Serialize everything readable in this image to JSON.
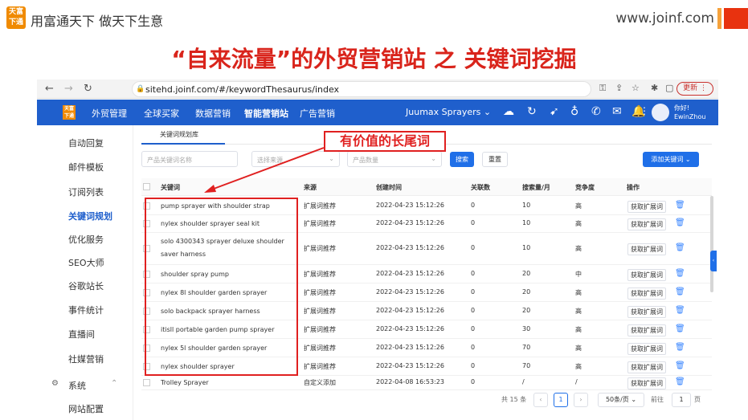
{
  "slide": {
    "logo_line1": "天富",
    "logo_line2": "下通",
    "company": "用富通天下  做天下生意",
    "site_url": "www.joinf.com",
    "title": "“自来流量”的外贸营销站 之 关键词挖掘"
  },
  "browser": {
    "url": "sitehd.joinf.com/#/keywordThesaurus/index",
    "update_label": "更新"
  },
  "topnav": {
    "logo_text": "天富下通",
    "items": [
      "外贸管理",
      "全球买家",
      "数据营销",
      "智能营销站",
      "广告营销"
    ],
    "active_index": 3,
    "product": "Juumax Sprayers",
    "user_greeting": "你好!",
    "user_name": "EwinZhou"
  },
  "sidebar": {
    "items": [
      "自动回复",
      "邮件模板",
      "订阅列表",
      "关键词规划",
      "优化服务",
      "SEO大师",
      "谷歌站长",
      "事件统计",
      "直播间",
      "社媒营销",
      "系统",
      "网站配置"
    ],
    "active_index": 3
  },
  "tab_label": "关键词规划库",
  "filters": {
    "keyword_placeholder": "产品关键词名称",
    "source_placeholder": "选择来源",
    "count_placeholder": "产品数量",
    "search_label": "搜索",
    "reset_label": "重置",
    "add_label": "添加关键词"
  },
  "callout": "有价值的长尾词",
  "table": {
    "columns": [
      "关键词",
      "来源",
      "创建时间",
      "关联数",
      "搜索量/月",
      "竞争度",
      "操作"
    ],
    "action_label": "获取扩展词",
    "rows": [
      {
        "keyword": "pump sprayer with shoulder strap",
        "source": "扩展词推荐",
        "time": "2022-04-23 15:12:26",
        "related": "0",
        "volume": "10",
        "competition": "高"
      },
      {
        "keyword": "nylex shoulder sprayer seal kit",
        "source": "扩展词推荐",
        "time": "2022-04-23 15:12:26",
        "related": "0",
        "volume": "10",
        "competition": "高"
      },
      {
        "keyword": "solo 4300343 sprayer deluxe shoulder saver harness",
        "source": "扩展词推荐",
        "time": "2022-04-23 15:12:26",
        "related": "0",
        "volume": "10",
        "competition": "高"
      },
      {
        "keyword": "shoulder spray pump",
        "source": "扩展词推荐",
        "time": "2022-04-23 15:12:26",
        "related": "0",
        "volume": "20",
        "competition": "中"
      },
      {
        "keyword": "nylex 8l shoulder garden sprayer",
        "source": "扩展词推荐",
        "time": "2022-04-23 15:12:26",
        "related": "0",
        "volume": "20",
        "competition": "高"
      },
      {
        "keyword": "solo backpack sprayer harness",
        "source": "扩展词推荐",
        "time": "2022-04-23 15:12:26",
        "related": "0",
        "volume": "20",
        "competition": "高"
      },
      {
        "keyword": "itisll portable garden pump sprayer",
        "source": "扩展词推荐",
        "time": "2022-04-23 15:12:26",
        "related": "0",
        "volume": "30",
        "competition": "高"
      },
      {
        "keyword": "nylex 5l shoulder garden sprayer",
        "source": "扩展词推荐",
        "time": "2022-04-23 15:12:26",
        "related": "0",
        "volume": "70",
        "competition": "高"
      },
      {
        "keyword": "nylex shoulder sprayer",
        "source": "扩展词推荐",
        "time": "2022-04-23 15:12:26",
        "related": "0",
        "volume": "70",
        "competition": "高"
      },
      {
        "keyword": "Trolley Sprayer",
        "source": "自定义添加",
        "time": "2022-04-08 16:53:23",
        "related": "0",
        "volume": "/",
        "competition": "/"
      }
    ]
  },
  "pagination": {
    "total": "共 15 条",
    "current": "1",
    "page_size": "50条/页",
    "goto_label": "前往",
    "goto_value": "1",
    "page_unit": "页"
  },
  "colors": {
    "accent": "#1f5fcc",
    "highlight": "#e02020",
    "title": "#d9241b"
  }
}
